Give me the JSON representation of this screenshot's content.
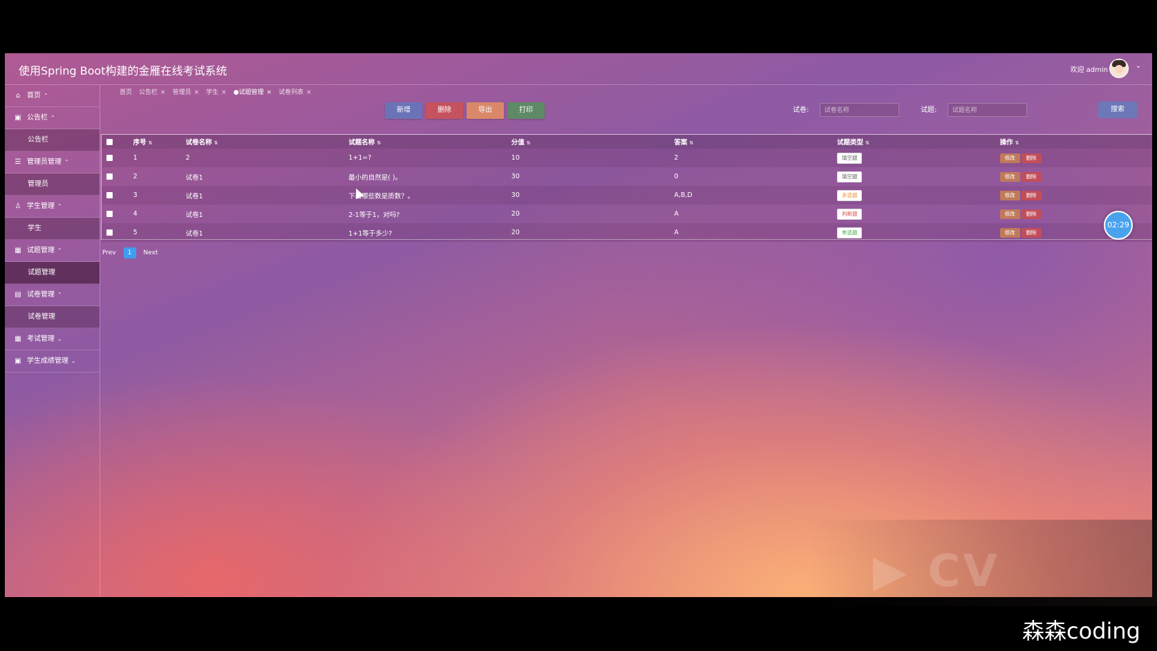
{
  "header": {
    "title": "使用Spring Boot构建的金雁在线考试系统",
    "welcome": "欢迎 admin",
    "caret": "⌄"
  },
  "sidebar": [
    {
      "icon": "home-icon",
      "glyph": "⌂",
      "label": "首页",
      "arrow": "⌃",
      "sub": []
    },
    {
      "icon": "notice-icon",
      "glyph": "▣",
      "label": "公告栏",
      "arrow": "⌃",
      "sub": [
        {
          "label": "公告栏",
          "active": false
        }
      ]
    },
    {
      "icon": "admin-icon",
      "glyph": "☰",
      "label": "管理员管理",
      "arrow": "⌃",
      "sub": [
        {
          "label": "管理员",
          "active": false
        }
      ]
    },
    {
      "icon": "user-icon",
      "glyph": "♙",
      "label": "学生管理",
      "arrow": "⌃",
      "sub": [
        {
          "label": "学生",
          "active": false
        }
      ]
    },
    {
      "icon": "grid-icon",
      "glyph": "▦",
      "label": "试题管理",
      "arrow": "⌃",
      "sub": [
        {
          "label": "试题管理",
          "active": true
        }
      ]
    },
    {
      "icon": "paper-icon",
      "glyph": "▤",
      "label": "试卷管理",
      "arrow": "⌃",
      "sub": [
        {
          "label": "试卷管理",
          "active": false
        }
      ]
    },
    {
      "icon": "exam-icon",
      "glyph": "▦",
      "label": "考试管理",
      "arrow": "⌄",
      "sub": []
    },
    {
      "icon": "score-icon",
      "glyph": "▣",
      "label": "学生成绩管理",
      "arrow": "⌄",
      "sub": []
    }
  ],
  "tabs": [
    {
      "label": "首页",
      "closable": false,
      "active": false
    },
    {
      "label": "公告栏",
      "closable": true,
      "active": false
    },
    {
      "label": "管理员",
      "closable": true,
      "active": false
    },
    {
      "label": "学生",
      "closable": true,
      "active": false
    },
    {
      "label": "●试题管理",
      "closable": true,
      "active": true
    },
    {
      "label": "试卷列表",
      "closable": true,
      "active": false
    }
  ],
  "toolbar": [
    {
      "name": "add-button",
      "label": "新增",
      "color": "#6b73b8"
    },
    {
      "name": "delete-button",
      "label": "删除",
      "color": "#c5525e"
    },
    {
      "name": "export-button",
      "label": "导出",
      "color": "#d9886a"
    },
    {
      "name": "print-button",
      "label": "打印",
      "color": "#5f8a66"
    }
  ],
  "search": {
    "paper_label": "试卷:",
    "paper_placeholder": "试卷名称",
    "question_label": "试题:",
    "question_placeholder": "试题名称",
    "button": "搜索"
  },
  "table": {
    "columns": [
      "序号",
      "试卷名称",
      "试题名称",
      "分值",
      "答案",
      "试题类型",
      "操作"
    ],
    "sort_glyph": "⇅",
    "rows": [
      {
        "no": "1",
        "paper": "2",
        "question": "1+1=?",
        "score": "10",
        "answer": "2",
        "type": "填空题",
        "type_color": "#666666"
      },
      {
        "no": "2",
        "paper": "试卷1",
        "question": "最小的自然是( )。",
        "score": "30",
        "answer": "0",
        "type": "填空题",
        "type_color": "#666666"
      },
      {
        "no": "3",
        "paper": "试卷1",
        "question": "下面哪些数是质数？。",
        "score": "30",
        "answer": "A,B,D",
        "type": "多选题",
        "type_color": "#e8953a"
      },
      {
        "no": "4",
        "paper": "试卷1",
        "question": "2-1等于1，对吗?",
        "score": "20",
        "answer": "A",
        "type": "判断题",
        "type_color": "#e04e4e"
      },
      {
        "no": "5",
        "paper": "试卷1",
        "question": "1+1等于多少?",
        "score": "20",
        "answer": "A",
        "type": "单选题",
        "type_color": "#4caf50"
      }
    ],
    "edit_label": "修改",
    "delete_label": "删除"
  },
  "pager": {
    "prev": "Prev",
    "current": "1",
    "next": "Next"
  },
  "timer": "02:29",
  "watermark": "森森coding",
  "overlay_logo": "▶ CV"
}
